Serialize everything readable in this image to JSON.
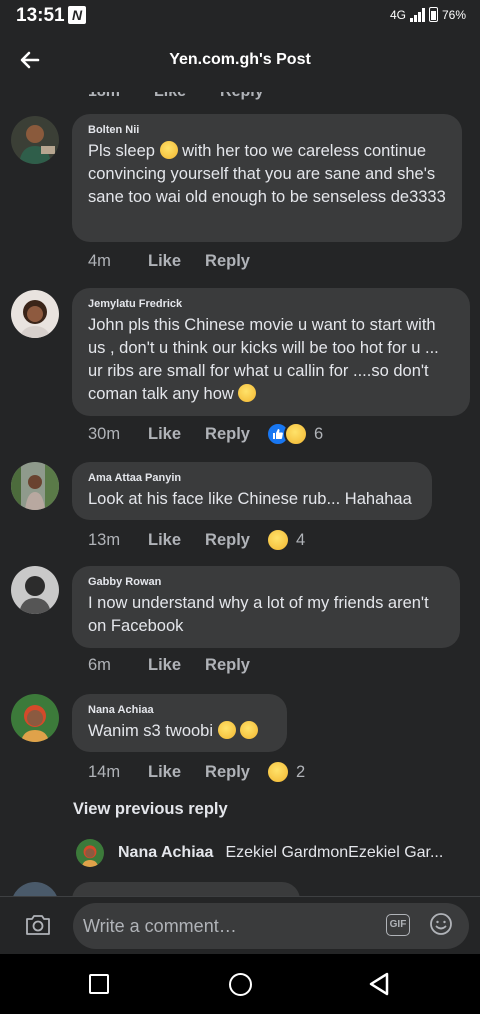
{
  "status": {
    "time": "13:51",
    "network": "4G",
    "battery": "76%"
  },
  "header": {
    "title": "Yen.com.gh's Post"
  },
  "partial": {
    "time": "18m",
    "like": "Like",
    "reply": "Reply"
  },
  "comments": [
    {
      "author": "Bolten Nii",
      "text_before": "Pls sleep ",
      "text_after": " with her too we careless continue convincing yourself that you are sane and she's sane too wai old enough to be senseless de3333",
      "time": "4m",
      "like": "Like",
      "reply": "Reply",
      "count": ""
    },
    {
      "author": "Jemylatu Fredrick",
      "text_before": "John pls this Chinese movie u want to start with us , don't u think our kicks will be too hot  for u ... ur ribs are small for what u callin for  ....so don't coman talk any how ",
      "text_after": "",
      "time": "30m",
      "like": "Like",
      "reply": "Reply",
      "count": "6"
    },
    {
      "author": "Ama Attaa Panyin",
      "text_before": "Look at his face like Chinese rub... Hahahaa",
      "text_after": "",
      "time": "13m",
      "like": "Like",
      "reply": "Reply",
      "count": "4"
    },
    {
      "author": "Gabby Rowan",
      "text_before": "I now understand why a lot of my friends aren't on Facebook",
      "text_after": "",
      "time": "6m",
      "like": "Like",
      "reply": "Reply",
      "count": ""
    },
    {
      "author": "Nana Achiaa",
      "text_before": "Wanim s3 twoobi ",
      "text_after": "",
      "time": "14m",
      "like": "Like",
      "reply": "Reply",
      "count": "2"
    }
  ],
  "view_previous": "View previous reply",
  "reply_preview": {
    "name": "Nana Achiaa",
    "text": "Ezekiel GardmonEzekiel Gar..."
  },
  "composer": {
    "placeholder": "Write a comment…",
    "gif": "GIF"
  }
}
